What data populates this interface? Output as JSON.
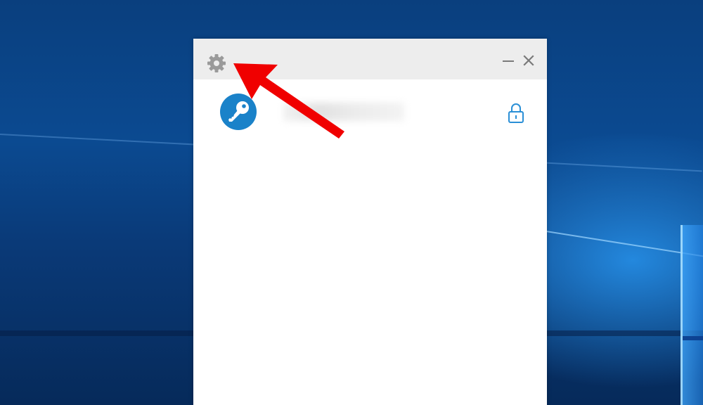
{
  "titlebar": {
    "settings_icon": "gear-icon",
    "minimize_icon": "minimize-icon",
    "close_icon": "close-icon"
  },
  "account": {
    "avatar_icon": "key-icon",
    "name": "",
    "lock_icon": "lock-icon"
  },
  "annotation": {
    "arrow_icon": "arrow-icon",
    "arrow_color": "#f00000"
  },
  "colors": {
    "accent": "#1a82c9",
    "titlebar_bg": "#ededed",
    "desktop_blue": "#0b4a91"
  }
}
